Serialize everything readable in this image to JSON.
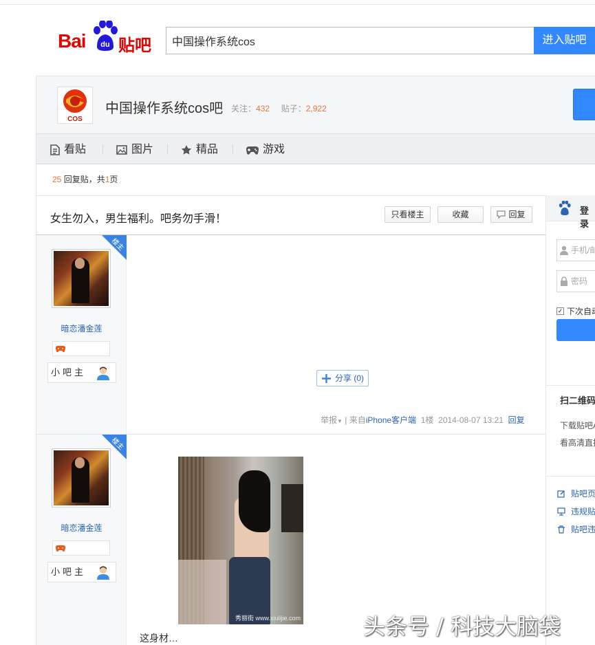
{
  "header": {
    "logo_text_left": "Bai",
    "logo_text_paw": "du",
    "logo_text_right": "贴吧",
    "search_value": "中国操作系统cos",
    "search_button": "进入贴吧"
  },
  "forum": {
    "logo_text": "COS",
    "name": "中国操作系统cos吧",
    "follow_label": "关注：",
    "follow_count": "432",
    "posts_label": "贴子：",
    "posts_count": "2,922",
    "nav": [
      "看贴",
      "图片",
      "精品",
      "游戏"
    ]
  },
  "reply_info": {
    "count": "25",
    "text_a": " 回复贴，共",
    "pages": "1",
    "text_b": "页"
  },
  "thread": {
    "title": "女生勿入，男生福利。吧务勿手滑！",
    "btn_only_op": "只看楼主",
    "btn_collect": "收藏",
    "btn_reply": "回复"
  },
  "posts": [
    {
      "badge": "楼主",
      "author": "暗恋潘金莲",
      "role": "小吧主",
      "share": "分享",
      "share_count": "(0)",
      "report": "举报",
      "from_prefix": "| 来自",
      "client": "iPhone客户端",
      "floor": "1楼",
      "time": "2014-08-07 13:21",
      "reply": "回复"
    },
    {
      "badge": "楼主",
      "author": "暗恋潘金莲",
      "role": "小吧主",
      "image_watermark": "秀丽街 www.xiulijie.com",
      "caption": "这身材…"
    }
  ],
  "sidebar": {
    "login": "登录",
    "phone_placeholder": "手机/邮",
    "password_placeholder": "密码",
    "remember": "下次自动",
    "qr_title": "扫二维码",
    "qr_line1": "下载贴吧A",
    "qr_line2": "看高清直播",
    "links": [
      "贴吧页",
      "违规贴",
      "贴吧违"
    ]
  },
  "watermark": "头条号 / 科技大脑袋",
  "colors": {
    "brand_red": "#e10601",
    "accent_blue": "#3388ff",
    "link_blue": "#2d64b3",
    "count_orange": "#e4783a"
  }
}
